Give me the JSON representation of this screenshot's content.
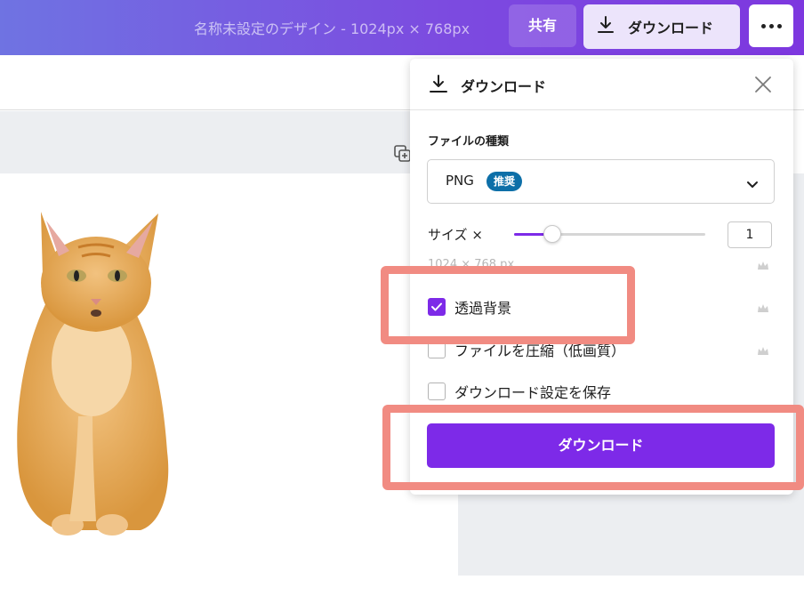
{
  "header": {
    "doc_title": "名称未設定のデザイン - 1024px × 768px",
    "share_label": "共有",
    "download_label": "ダウンロード",
    "more_icon": "ellipsis-icon"
  },
  "download_panel": {
    "title": "ダウンロード",
    "file_type_label": "ファイルの種類",
    "file_type_value": "PNG",
    "recommended_badge": "推奨",
    "size_label": "サイズ ×",
    "size_value": "1",
    "size_fraction": 0.2,
    "dimensions_text": "1024 × 768 px",
    "options": [
      {
        "label": "透過背景",
        "checked": true
      },
      {
        "label": "ファイルを圧縮（低画質）",
        "checked": false
      },
      {
        "label": "ダウンロード設定を保存",
        "checked": false
      }
    ],
    "download_button": "ダウンロード"
  },
  "colors": {
    "accent": "#7d2ae8",
    "badge": "#0d6fa8",
    "highlight": "#f18b82"
  }
}
